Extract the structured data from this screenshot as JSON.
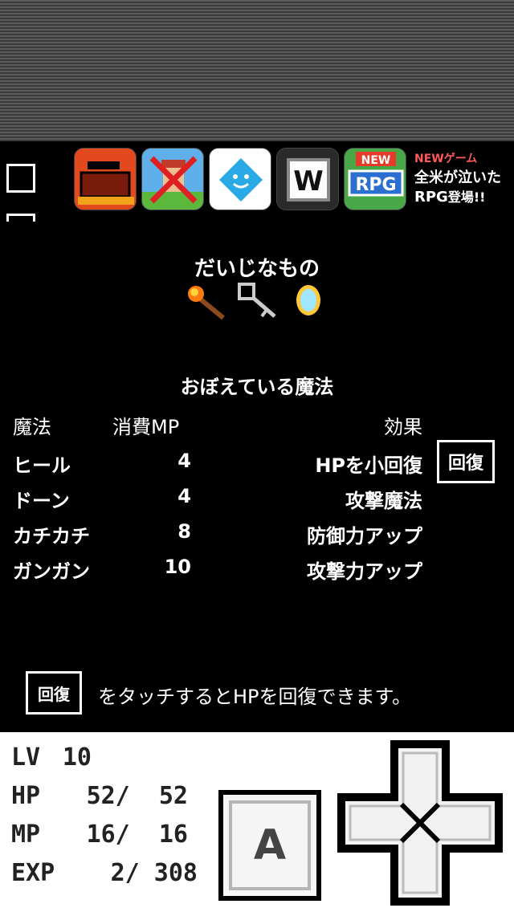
{
  "app_icons": [
    "cart-game-icon",
    "crossed-hero-icon",
    "smile-diamond-icon",
    "w-app-icon",
    "new-rpg-icon"
  ],
  "promo": {
    "line1": "NEWゲーム",
    "line2": "全米が泣いた",
    "line3": "RPG",
    "line3_suffix": "登場!!"
  },
  "key_items": {
    "title": "だいじなもの",
    "items": [
      "torch-icon",
      "key-icon",
      "mirror-icon"
    ]
  },
  "spells": {
    "title": "おぼえている魔法",
    "headers": {
      "name": "魔法",
      "mp": "消費MP",
      "effect": "効果"
    },
    "rows": [
      {
        "name": "ヒール",
        "mp": "4",
        "effect": "HPを小回復"
      },
      {
        "name": "ドーン",
        "mp": "4",
        "effect": "攻撃魔法"
      },
      {
        "name": "カチカチ",
        "mp": "8",
        "effect": "防御力アップ"
      },
      {
        "name": "ガンガン",
        "mp": "10",
        "effect": "攻撃力アップ"
      }
    ],
    "heal_button": "回復"
  },
  "hint": {
    "button": "回復",
    "text": "をタッチするとHPを回復できます。"
  },
  "status": {
    "lv": {
      "label": "LV",
      "value": "10"
    },
    "hp": {
      "label": "HP",
      "value": "52/  52"
    },
    "mp": {
      "label": "MP",
      "value": "16/  16"
    },
    "exp": {
      "label": "EXP",
      "value": "2/ 308"
    }
  },
  "controls": {
    "a_button": "A"
  },
  "colors": {
    "promo_new": "#ff5a5a",
    "background": "#000000",
    "panel": "#ffffff"
  }
}
